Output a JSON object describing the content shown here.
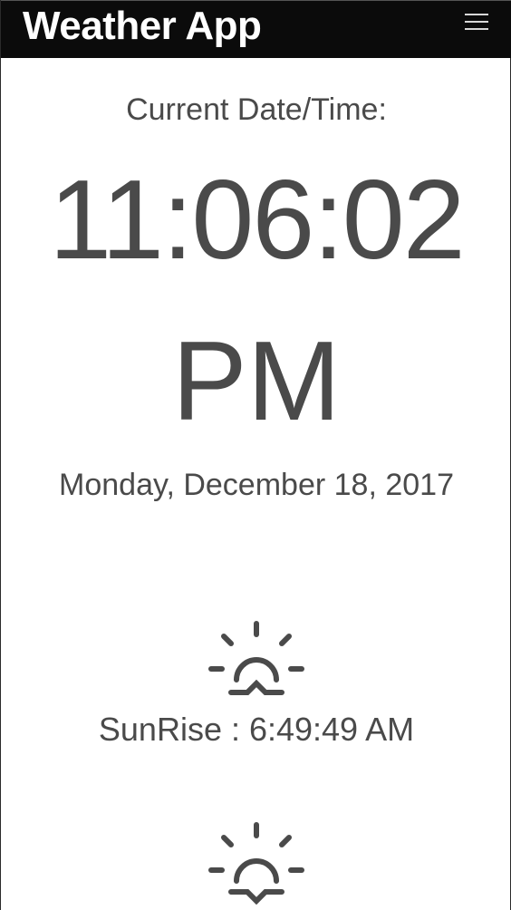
{
  "app": {
    "title": "Weather App"
  },
  "navbar": {
    "menu_icon": "hamburger-menu-icon"
  },
  "clock": {
    "label": "Current Date/Time:",
    "time": "11:06:02",
    "ampm": "PM",
    "date": "Monday, December 18, 2017"
  },
  "sun": {
    "sunrise_icon": "sunrise-icon",
    "sunrise_text": "SunRise : 6:49:49 AM",
    "sunset_icon": "sunset-icon"
  }
}
